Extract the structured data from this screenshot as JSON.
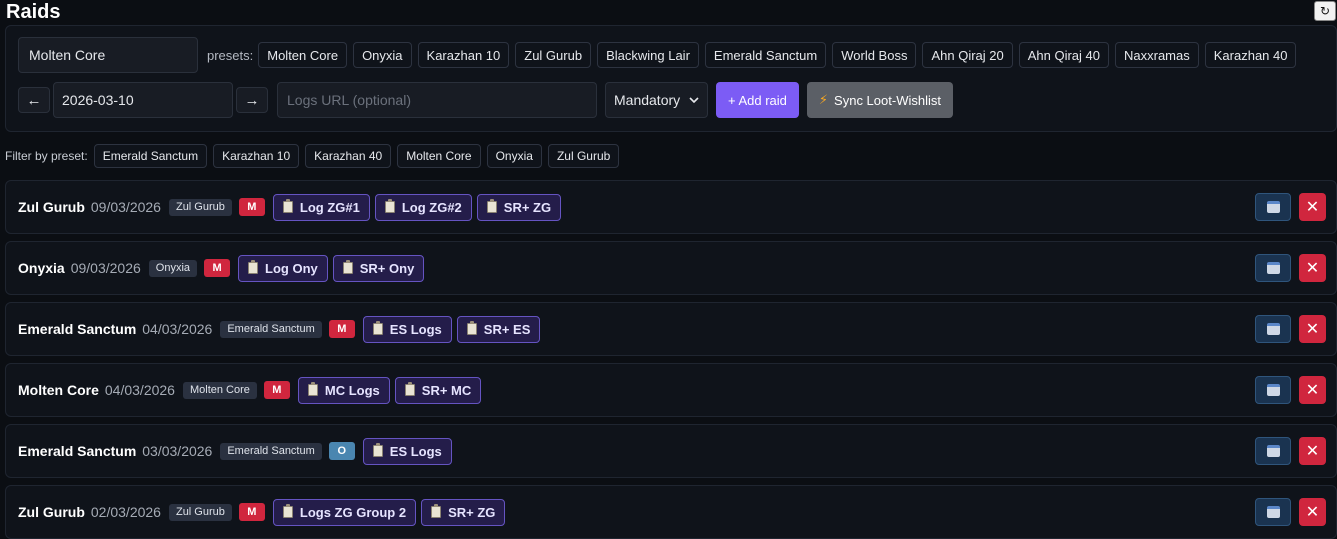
{
  "page": {
    "title": "Raids"
  },
  "form": {
    "raid_name_value": "Molten Core",
    "presets_label": "presets:",
    "presets": [
      "Molten Core",
      "Onyxia",
      "Karazhan 10",
      "Zul Gurub",
      "Blackwing Lair",
      "Emerald Sanctum",
      "World Boss",
      "Ahn Qiraj 20",
      "Ahn Qiraj 40",
      "Naxxramas",
      "Karazhan 40"
    ],
    "prev_arrow": "←",
    "next_arrow": "→",
    "date_value": "2026-03-10",
    "logs_placeholder": "Logs URL (optional)",
    "type_selected": "Mandatory",
    "add_label": "+ Add raid",
    "sync_label": "Sync Loot-Wishlist"
  },
  "filter": {
    "label": "Filter by preset:",
    "presets": [
      "Emerald Sanctum",
      "Karazhan 10",
      "Karazhan 40",
      "Molten Core",
      "Onyxia",
      "Zul Gurub"
    ]
  },
  "raids": [
    {
      "name": "Zul Gurub",
      "date": "09/03/2026",
      "tag": "Zul Gurub",
      "badge": "M",
      "links": [
        "Log ZG#1",
        "Log ZG#2",
        "SR+ ZG"
      ]
    },
    {
      "name": "Onyxia",
      "date": "09/03/2026",
      "tag": "Onyxia",
      "badge": "M",
      "links": [
        "Log Ony",
        "SR+ Ony"
      ]
    },
    {
      "name": "Emerald Sanctum",
      "date": "04/03/2026",
      "tag": "Emerald Sanctum",
      "badge": "M",
      "links": [
        "ES Logs",
        "SR+ ES"
      ]
    },
    {
      "name": "Molten Core",
      "date": "04/03/2026",
      "tag": "Molten Core",
      "badge": "M",
      "links": [
        "MC Logs",
        "SR+ MC"
      ]
    },
    {
      "name": "Emerald Sanctum",
      "date": "03/03/2026",
      "tag": "Emerald Sanctum",
      "badge": "O",
      "links": [
        "ES Logs"
      ]
    },
    {
      "name": "Zul Gurub",
      "date": "02/03/2026",
      "tag": "Zul Gurub",
      "badge": "M",
      "links": [
        "Logs ZG Group 2",
        "SR+ ZG"
      ]
    }
  ],
  "icons": {
    "refresh": "↻",
    "delete": "✕",
    "bolt": "⚡"
  },
  "colors": {
    "accent": "#7c5cf5",
    "mandatory": "#d0263e",
    "optional": "#4a86b0",
    "delete": "#d0263e"
  }
}
